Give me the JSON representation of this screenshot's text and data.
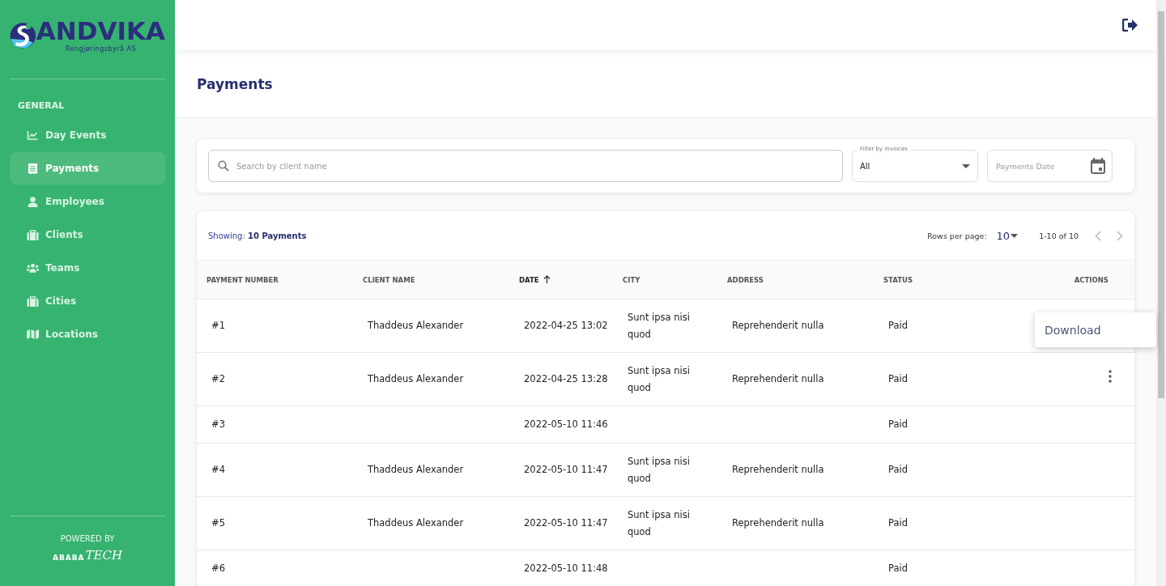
{
  "sidebar": {
    "logo": {
      "name": "ANDVIKA",
      "tagline": "Rengjøringsbyrå AS"
    },
    "section": "GENERAL",
    "items": [
      {
        "label": "Day Events",
        "selected": false
      },
      {
        "label": "Payments",
        "selected": true
      },
      {
        "label": "Employees",
        "selected": false
      },
      {
        "label": "Clients",
        "selected": false
      },
      {
        "label": "Teams",
        "selected": false
      },
      {
        "label": "Cities",
        "selected": false
      },
      {
        "label": "Locations",
        "selected": false
      }
    ],
    "footer": {
      "powered_by": "POWERED BY",
      "brand": "ABABA",
      "brand_script": "TECH"
    }
  },
  "page": {
    "title": "Payments"
  },
  "filters": {
    "search": {
      "placeholder": "Search by client name"
    },
    "invoice_filter": {
      "label": "Filter by invoices",
      "value": "All"
    },
    "date": {
      "placeholder": "Payments Date"
    }
  },
  "table": {
    "showing_label": "Showing:",
    "showing_value": "10 Payments",
    "rows_per_page_label": "Rows per page:",
    "rows_per_page": "10",
    "range": "1-10 of 10",
    "columns": [
      {
        "label": "PAYMENT NUMBER",
        "sorted": false
      },
      {
        "label": "CLIENT NAME",
        "sorted": false
      },
      {
        "label": "DATE",
        "sorted": true
      },
      {
        "label": "CITY",
        "sorted": false
      },
      {
        "label": "ADDRESS",
        "sorted": false
      },
      {
        "label": "STATUS",
        "sorted": false
      },
      {
        "label": "ACTIONS",
        "sorted": false
      }
    ],
    "rows": [
      {
        "cells": [
          "#1",
          "Thaddeus Alexander",
          "2022-04-25 13:02",
          "Sunt ipsa nisi quod",
          "Reprehenderit nulla",
          "Paid"
        ]
      },
      {
        "cells": [
          "#2",
          "Thaddeus Alexander",
          "2022-04-25 13:28",
          "Sunt ipsa nisi quod",
          "Reprehenderit nulla",
          "Paid"
        ],
        "menu_button": true
      },
      {
        "cells": [
          "#3",
          "",
          "2022-05-10 11:46",
          "",
          "",
          "Paid"
        ],
        "menu_button": false
      },
      {
        "cells": [
          "#4",
          "Thaddeus Alexander",
          "2022-05-10 11:47",
          "Sunt ipsa nisi quod",
          "Reprehenderit nulla",
          "Paid"
        ],
        "menu_button": false
      },
      {
        "cells": [
          "#5",
          "Thaddeus Alexander",
          "2022-05-10 11:47",
          "Sunt ipsa nisi quod",
          "Reprehenderit nulla",
          "Paid"
        ],
        "menu_button": false
      },
      {
        "cells": [
          "#6",
          "",
          "2022-05-10 11:48",
          "",
          "",
          "Paid"
        ],
        "menu_button": false
      }
    ]
  },
  "action_menu": {
    "items": [
      "Download"
    ]
  }
}
